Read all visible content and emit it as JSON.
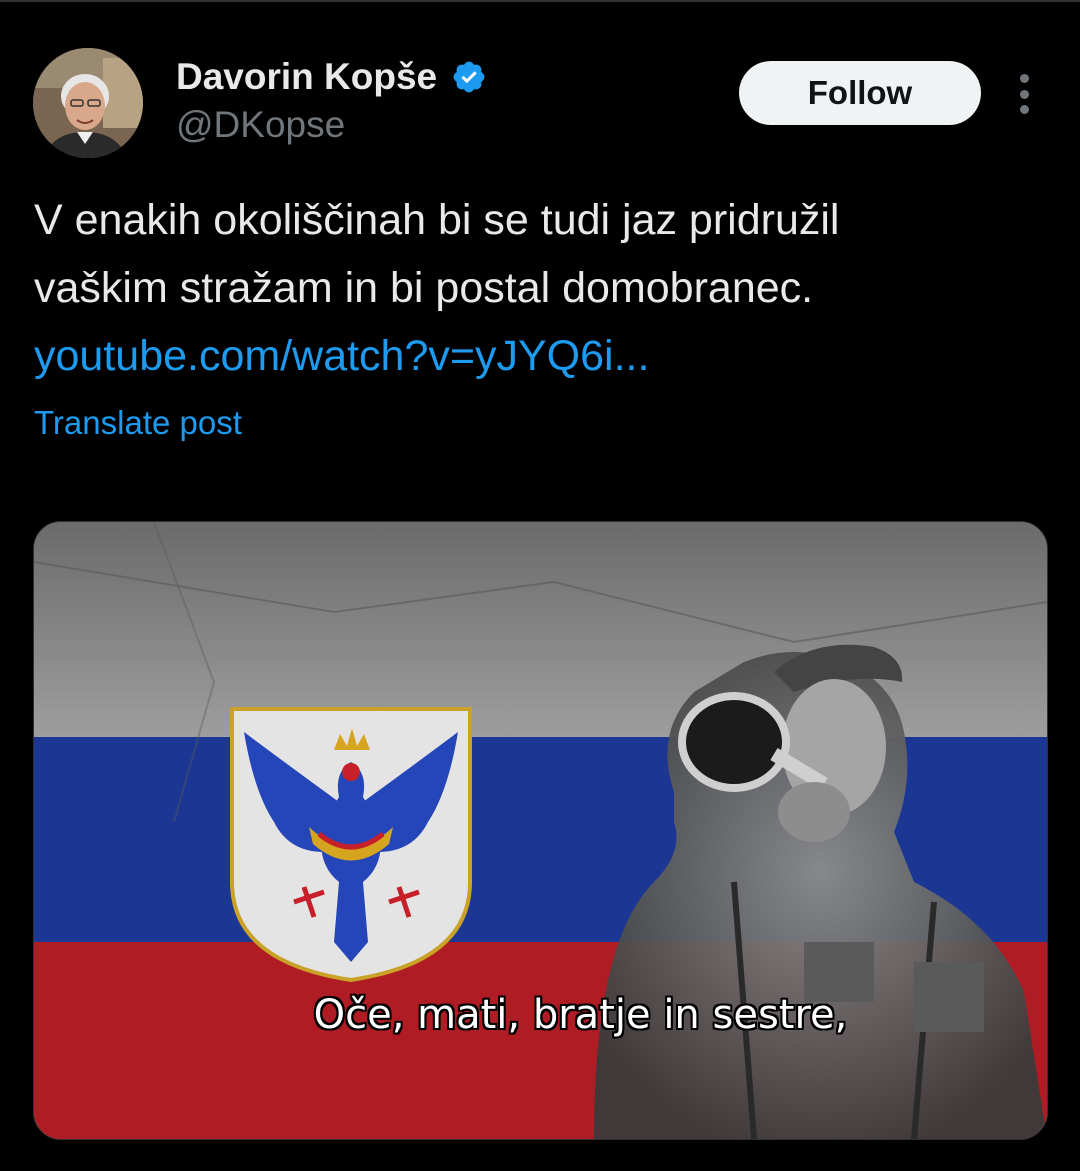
{
  "post": {
    "author": {
      "name": "Davorin Kopše",
      "handle": "@DKopse",
      "verified": true,
      "avatar_icon": "profile-photo"
    },
    "follow_label": "Follow",
    "more_icon": "more-vertical-icon",
    "text_lines": [
      "V enakih okoliščinah bi se tudi jaz pridružil",
      "vaškim stražam in bi postal domobranec."
    ],
    "link": "youtube.com/watch?v=yJYQ6i...",
    "translate_label": "Translate post",
    "media": {
      "subtitle": "Oče, mati, bratje in sestre,"
    }
  },
  "colors": {
    "background": "#000000",
    "text_primary": "#e7e9ea",
    "text_secondary": "#71767b",
    "accent": "#1d9bf0",
    "follow_button_bg": "#eff3f4",
    "flag_white": "#e8e8e8",
    "flag_blue": "#1f3fa8",
    "flag_red": "#c8202a"
  }
}
